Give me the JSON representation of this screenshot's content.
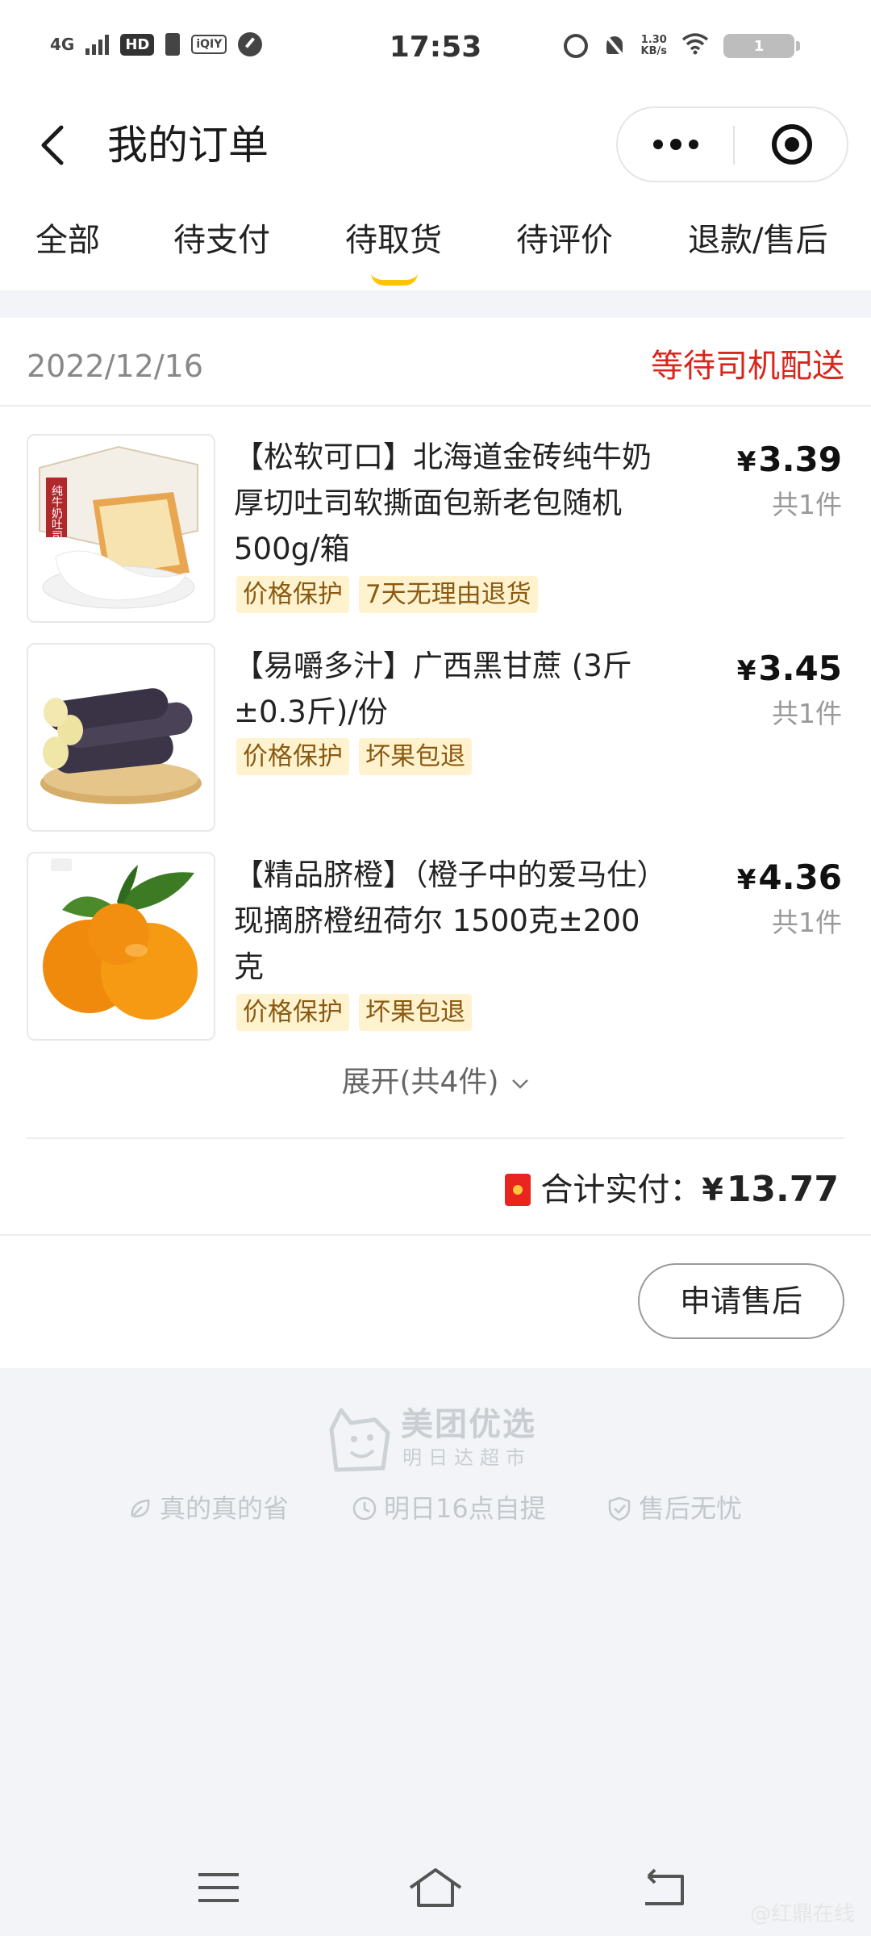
{
  "status_bar": {
    "network": "4G",
    "hd_label": "HD",
    "app_icon_label": "iQIY",
    "time": "17:53",
    "speed_value": "1.30",
    "speed_unit": "KB/s",
    "battery": "1"
  },
  "header": {
    "title": "我的订单"
  },
  "tabs": [
    {
      "label": "全部"
    },
    {
      "label": "待支付"
    },
    {
      "label": "待取货",
      "active": true
    },
    {
      "label": "待评价"
    },
    {
      "label": "退款/售后"
    }
  ],
  "order": {
    "date": "2022/12/16",
    "status": "等待司机配送",
    "items": [
      {
        "title": "【松软可口】北海道金砖纯牛奶厚切吐司软撕面包新老包随机 500g/箱",
        "tags": [
          "价格保护",
          "7天无理由退货"
        ],
        "price": "3.39",
        "qty": "共1件",
        "image_text": "纯牛奶吐司"
      },
      {
        "title": "【易嚼多汁】广西黑甘蔗 (3斤±0.3斤)/份",
        "tags": [
          "价格保护",
          "坏果包退"
        ],
        "price": "3.45",
        "qty": "共1件"
      },
      {
        "title": "【精品脐橙】（橙子中的爱马仕）现摘脐橙纽荷尔 1500克±200克",
        "tags": [
          "价格保护",
          "坏果包退"
        ],
        "price": "4.36",
        "qty": "共1件"
      }
    ],
    "currency": "¥",
    "expand_label": "展开(共4件)",
    "total_label": "合计实付：",
    "total_amount": "13.77",
    "after_sale_label": "申请售后"
  },
  "footer": {
    "brand_name": "美团优选",
    "brand_sub": "明日达超市",
    "slogans": [
      {
        "icon": "leaf-icon",
        "label": "真的真的省"
      },
      {
        "icon": "clock-icon",
        "label": "明日16点自提"
      },
      {
        "icon": "shield-icon",
        "label": "售后无忧"
      }
    ],
    "watermark": "@红鼎在线"
  },
  "colors": {
    "accent_yellow": "#ffc400",
    "status_red": "#d9261c",
    "tag_bg": "#fff3cf",
    "tag_text": "#8a5a12"
  }
}
